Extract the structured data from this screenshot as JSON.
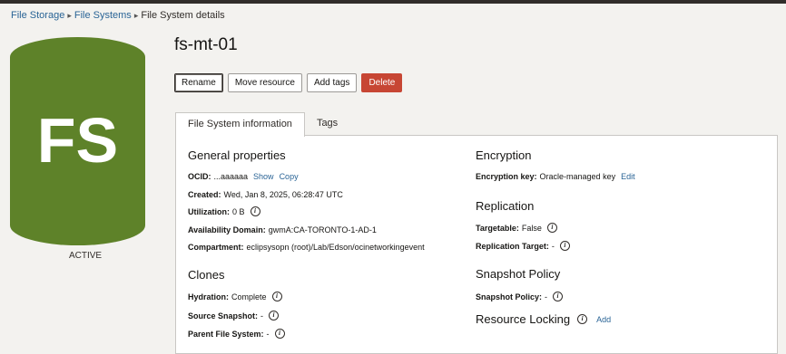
{
  "breadcrumb": {
    "items": [
      "File Storage",
      "File Systems",
      "File System details"
    ],
    "separator": "▸"
  },
  "resource": {
    "icon_text": "FS",
    "status": "ACTIVE",
    "title": "fs-mt-01"
  },
  "actions": {
    "rename": "Rename",
    "move": "Move resource",
    "add_tags": "Add tags",
    "delete": "Delete"
  },
  "tabs": [
    "File System information",
    "Tags"
  ],
  "general": {
    "heading": "General properties",
    "ocid_label": "OCID:",
    "ocid_value": "...aaaaaa",
    "show": "Show",
    "copy": "Copy",
    "created_label": "Created:",
    "created_value": "Wed, Jan 8, 2025, 06:28:47 UTC",
    "utilization_label": "Utilization:",
    "utilization_value": "0 B",
    "ad_label": "Availability Domain:",
    "ad_value": "gwmA:CA-TORONTO-1-AD-1",
    "compartment_label": "Compartment:",
    "compartment_value": "eclipsysopn (root)/Lab/Edson/ocinetworkingevent"
  },
  "clones": {
    "heading": "Clones",
    "hydration_label": "Hydration:",
    "hydration_value": "Complete",
    "source_label": "Source Snapshot:",
    "source_value": "-",
    "parent_label": "Parent File System:",
    "parent_value": "-"
  },
  "encryption": {
    "heading": "Encryption",
    "key_label": "Encryption key:",
    "key_value": "Oracle-managed key",
    "edit": "Edit"
  },
  "replication": {
    "heading": "Replication",
    "targetable_label": "Targetable:",
    "targetable_value": "False",
    "target_label": "Replication Target:",
    "target_value": "-"
  },
  "snapshot": {
    "heading": "Snapshot Policy",
    "policy_label": "Snapshot Policy:",
    "policy_value": "-"
  },
  "locking": {
    "heading": "Resource Locking",
    "add": "Add"
  },
  "colors": {
    "brand_green": "#5e8229",
    "delete_red": "#c74634",
    "link_blue": "#2a6496"
  },
  "icons": {
    "info": "info-circle-icon"
  }
}
